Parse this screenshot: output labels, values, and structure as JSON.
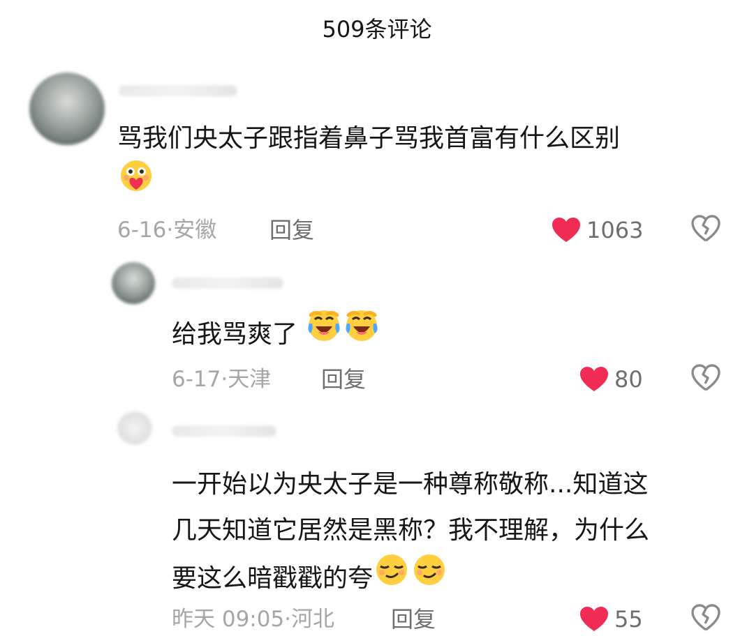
{
  "header": {
    "title": "509条评论"
  },
  "comments": [
    {
      "text": "骂我们央太子跟指着鼻子骂我首富有什么区别",
      "emoji": [
        "smiling-heart-face"
      ],
      "date": "6-16",
      "location": "安徽",
      "reply_label": "回复",
      "likes": "1063",
      "liked": true
    },
    {
      "text": "给我骂爽了",
      "emoji": [
        "crying-laughing-face",
        "crying-laughing-face"
      ],
      "date": "6-17",
      "location": "天津",
      "reply_label": "回复",
      "likes": "80",
      "liked": true
    },
    {
      "text_lines": [
        "一开始以为央太子是一种尊称敬称...知道这",
        "几天知道它居然是黑称？我不理解，为什么",
        "要这么暗戳戳的夸"
      ],
      "emoji": [
        "smirk-face",
        "smirk-face"
      ],
      "date": "昨天 09:05",
      "location": "河北",
      "reply_label": "回复",
      "likes": "55",
      "liked": true
    }
  ],
  "colors": {
    "like_heart": "#f02c55",
    "meta_gray": "#a6a6a6",
    "reply_gray": "#6e6e6e"
  }
}
